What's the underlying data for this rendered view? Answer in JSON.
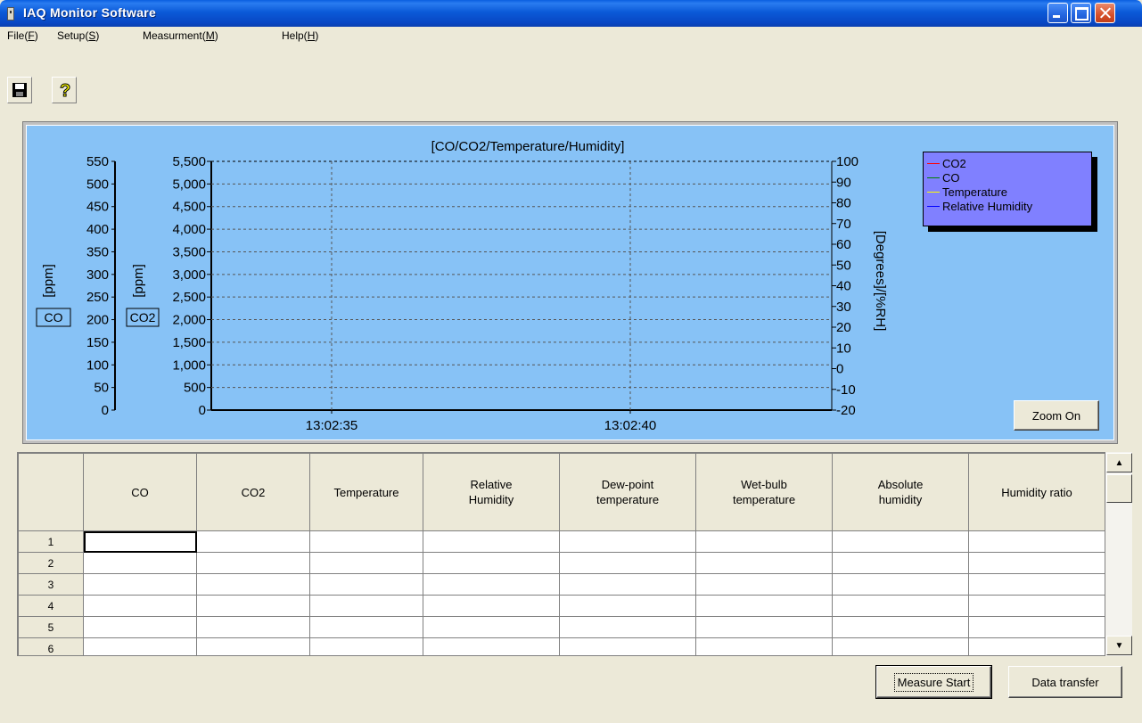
{
  "window": {
    "title": "IAQ Monitor Software"
  },
  "menu": [
    {
      "label": "File(",
      "key": "F",
      "tail": ")"
    },
    {
      "label": "Setup(",
      "key": "S",
      "tail": ")"
    },
    {
      "label": "Measurment(",
      "key": "M",
      "tail": ")"
    },
    {
      "label": "Help(",
      "key": "H",
      "tail": ")"
    }
  ],
  "toolbar": {
    "save": "save-icon",
    "help": "help-icon"
  },
  "chart_data": {
    "type": "line",
    "title": "[CO/CO2/Temperature/Humidity]",
    "axes": {
      "co": {
        "label": "[ppm]",
        "tag": "CO",
        "ticks": [
          "550",
          "500",
          "450",
          "400",
          "350",
          "300",
          "250",
          "200",
          "150",
          "100",
          "50",
          "0"
        ],
        "ylim": [
          0,
          550
        ]
      },
      "co2": {
        "label": "[ppm]",
        "tag": "CO2",
        "ticks": [
          "5,500",
          "5,000",
          "4,500",
          "4,000",
          "3,500",
          "3,000",
          "2,500",
          "2,000",
          "1,500",
          "1,000",
          "500",
          "0"
        ],
        "ylim": [
          0,
          5500
        ]
      },
      "right": {
        "label": "[Degrees]/[%RH]",
        "ticks": [
          "100",
          "90",
          "80",
          "70",
          "60",
          "50",
          "40",
          "30",
          "20",
          "10",
          "0",
          "-10",
          "-20"
        ],
        "ylim": [
          -20,
          100
        ]
      },
      "x": {
        "ticks": [
          "13:02:35",
          "13:02:40"
        ]
      }
    },
    "series": [
      {
        "name": "CO2",
        "color": "#ff0000",
        "values": []
      },
      {
        "name": "CO",
        "color": "#008000",
        "values": []
      },
      {
        "name": "Temperature",
        "color": "#ffff00",
        "values": []
      },
      {
        "name": "Relative Humidity",
        "color": "#0000ff",
        "values": []
      }
    ],
    "grid": true,
    "legend": "top-right"
  },
  "zoom_button": "Zoom On",
  "table": {
    "columns": [
      "CO",
      "CO2",
      "Temperature",
      "Relative\nHumidity",
      "Dew-point\ntemperature",
      "Wet-bulb\ntemperature",
      "Absolute\nhumidity",
      "Humidity ratio"
    ],
    "rows": [
      "1",
      "2",
      "3",
      "4",
      "5",
      "6"
    ]
  },
  "buttons": {
    "measure_start": "Measure Start",
    "data_transfer": "Data transfer"
  },
  "colors": {
    "chart_bg": "#87c2f6",
    "legend_bg": "#8080ff",
    "title_bar": "#0a5fe0"
  }
}
